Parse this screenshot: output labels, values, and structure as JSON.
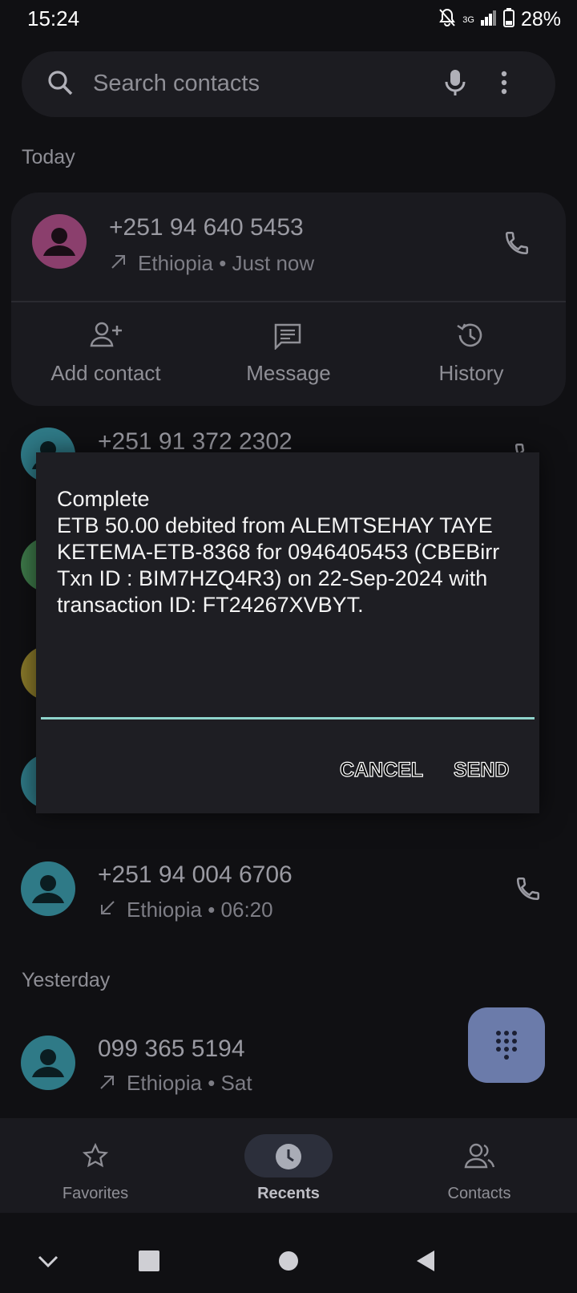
{
  "status_bar": {
    "time": "15:24",
    "network": "3G",
    "battery": "28%"
  },
  "search": {
    "placeholder": "Search contacts"
  },
  "sections": {
    "today": "Today",
    "yesterday": "Yesterday"
  },
  "expanded_call": {
    "number": "+251 94 640 5453",
    "location": "Ethiopia",
    "time": "Just now",
    "direction": "outgoing",
    "actions": [
      "Add contact",
      "Message",
      "History"
    ],
    "avatar_color": "#8b3f6d"
  },
  "calls": [
    {
      "number": "+251 91 372 2302",
      "avatar_color": "#2f7a87"
    },
    {
      "number": "+251 94 004 6706",
      "location": "Ethiopia",
      "time": "06:20",
      "direction": "incoming",
      "avatar_color": "#2f7a87"
    },
    {
      "number": "099 365 5194",
      "location": "Ethiopia",
      "time": "Sat",
      "direction": "outgoing",
      "avatar_color": "#2f7a87"
    }
  ],
  "dialog": {
    "message": "Complete\nETB 50.00 debited from ALEMTSEHAY TAYE KETEMA-ETB-8368 for 0946405453 (CBEBirr Txn ID : BIM7HZQ4R3) on 22-Sep-2024 with transaction ID: FT24267XVBYT.",
    "cancel": "CANCEL",
    "send": "SEND",
    "line_color": "#8fd3cb"
  },
  "bottom_nav": {
    "items": [
      "Favorites",
      "Recents",
      "Contacts"
    ],
    "active": "Recents"
  },
  "colors": {
    "background": "#101013",
    "fab": "#6b7baa"
  }
}
